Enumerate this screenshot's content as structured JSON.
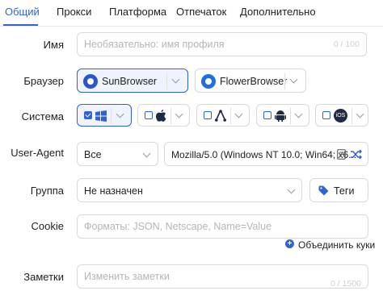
{
  "tabs": [
    "Общий",
    "Прокси",
    "Платформа",
    "Отпечаток",
    "Дополнительно"
  ],
  "name": {
    "label": "Имя",
    "placeholder": "Необязательно: имя профиля",
    "counter": "0 / 100"
  },
  "browser": {
    "label": "Браузер",
    "options": [
      "SunBrowser",
      "FlowerBrowser"
    ],
    "selected": "SunBrowser"
  },
  "system": {
    "label": "Система",
    "options": [
      {
        "name": "Windows",
        "icon": "windows-icon",
        "checked": true
      },
      {
        "name": "macOS",
        "icon": "apple-icon",
        "checked": false
      },
      {
        "name": "Linux",
        "icon": "linux-icon",
        "checked": false
      },
      {
        "name": "Android",
        "icon": "android-icon",
        "checked": false
      },
      {
        "name": "iOS",
        "icon": "ios-icon",
        "checked": false,
        "badge": "iOS"
      }
    ]
  },
  "user_agent": {
    "label": "User-Agent",
    "mode": "Все",
    "value": "Mozilla/5.0 (Windows NT 10.0; Win64; x6..."
  },
  "group": {
    "label": "Группа",
    "value": "Не назначен",
    "tags_label": "Теги"
  },
  "cookie": {
    "label": "Cookie",
    "placeholder": "Форматы: JSON, Netscape, Name=Value",
    "merge_label": "Объединить куки"
  },
  "notes": {
    "label": "Заметки",
    "placeholder": "Изменить заметки",
    "counter": "0 / 1500"
  },
  "colors": {
    "accent": "#2f63d6",
    "border": "#d9d9d9",
    "placeholder": "#b5b5b5"
  }
}
